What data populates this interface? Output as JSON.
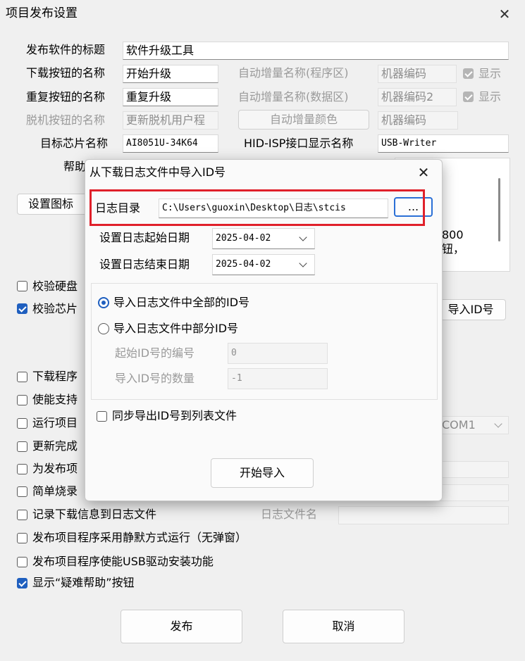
{
  "window": {
    "title": "项目发布设置"
  },
  "form": {
    "title_label": "发布软件的标题",
    "title_value": "软件升级工具",
    "download_label": "下载按钮的名称",
    "download_value": "开始升级",
    "auto_prog_label": "自动增量名称(程序区)",
    "auto_prog_value": "机器编码",
    "show1": "显示",
    "repeat_label": "重复按钮的名称",
    "repeat_value": "重复升级",
    "auto_data_label": "自动增量名称(数据区)",
    "auto_data_value": "机器编码2",
    "show2": "显示",
    "offline_label": "脱机按钮的名称",
    "offline_value": "更新脱机用户程",
    "auto_color_button": "自动增量颜色",
    "auto_color_value": "机器编码",
    "chip_label": "目标芯片名称",
    "chip_value": "AI8051U-34K64",
    "hid_label": "HID-ISP接口显示名称",
    "hid_value": "USB-Writer",
    "help_label": "帮助",
    "set_icon_button": "设置图标",
    "help_text_line1": "800",
    "help_text_line2": "钮，",
    "import_id_button": "导入ID号",
    "com_value": "COM1",
    "logfile_label": "日志文件名"
  },
  "checkboxes": [
    {
      "label": "校验硬盘",
      "checked": false
    },
    {
      "label": "校验芯片",
      "checked": true
    },
    {
      "label": "下载程序",
      "checked": false
    },
    {
      "label": "使能支持",
      "checked": false
    },
    {
      "label": "运行项目",
      "checked": false
    },
    {
      "label": "更新完成",
      "checked": false
    },
    {
      "label": "为发布项",
      "checked": false
    },
    {
      "label": "简单烧录",
      "checked": false
    },
    {
      "label": "记录下载信息到日志文件",
      "checked": false
    },
    {
      "label": "发布项目程序采用静默方式运行（无弹窗）",
      "checked": false
    },
    {
      "label": "发布项目程序使能USB驱动安装功能",
      "checked": false
    },
    {
      "label": "显示“疑难帮助”按钮",
      "checked": true
    }
  ],
  "footer": {
    "publish": "发布",
    "cancel": "取消"
  },
  "dialog": {
    "title": "从下载日志文件中导入ID号",
    "log_dir_label": "日志目录",
    "log_dir_value": "C:\\Users\\guoxin\\Desktop\\日志\\stcis",
    "browse_button": "...",
    "start_date_label": "设置日志起始日期",
    "start_date": "2025-04-02",
    "end_date_label": "设置日志结束日期",
    "end_date": "2025-04-02",
    "radio_all": "导入日志文件中全部的ID号",
    "radio_part": "导入日志文件中部分ID号",
    "start_id_label": "起始ID号的编号",
    "start_id_value": "0",
    "count_label": "导入ID号的数量",
    "count_value": "-1",
    "sync_export": "同步导出ID号到列表文件",
    "start_import_button": "开始导入"
  }
}
